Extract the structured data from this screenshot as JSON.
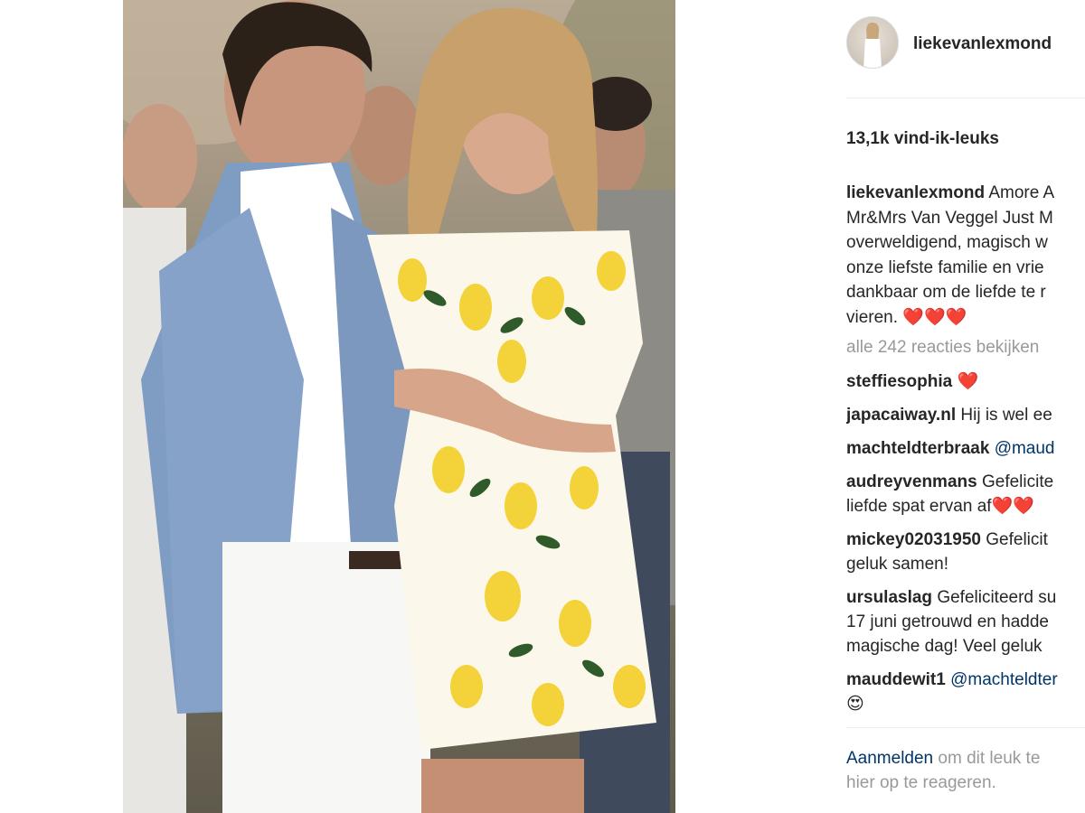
{
  "post": {
    "username": "liekevanlexmond",
    "likes": "13,1k vind-ik-leuks",
    "caption": {
      "username": "liekevanlexmond",
      "lines": [
        "Amore A",
        "Mr&Mrs Van Veggel Just M",
        "overweldigend, magisch w",
        "onze liefste familie en vrie",
        "dankbaar om de liefde te r",
        "vieren. ❤️❤️❤️"
      ]
    },
    "view_all_comments": "alle 242 reacties bekijken",
    "comments": [
      {
        "username": "steffiesophia",
        "lines": [
          "❤️"
        ]
      },
      {
        "username": "japacaiway.nl",
        "lines": [
          "Hij is wel ee"
        ]
      },
      {
        "username": "machteldterbraak",
        "mention": "@maud"
      },
      {
        "username": "audreyvenmans",
        "lines": [
          "Gefelicite",
          "liefde spat ervan af❤️❤️"
        ]
      },
      {
        "username": "mickey02031950",
        "lines": [
          "Gefelicit",
          "geluk samen!"
        ]
      },
      {
        "username": "ursulaslag",
        "lines": [
          "Gefeliciteerd su",
          "17 juni getrouwd en hadde",
          "magische dag! Veel geluk"
        ]
      },
      {
        "username": "mauddewit1",
        "mention": "@machteldter",
        "lines": [
          "😍"
        ]
      }
    ],
    "login_prompt": {
      "link": "Aanmelden",
      "rest": "om dit leuk te",
      "line2": "hier op te reageren."
    }
  },
  "colors": {
    "text": "#262626",
    "muted": "#999999",
    "link": "#003569",
    "divider": "#efefef"
  }
}
